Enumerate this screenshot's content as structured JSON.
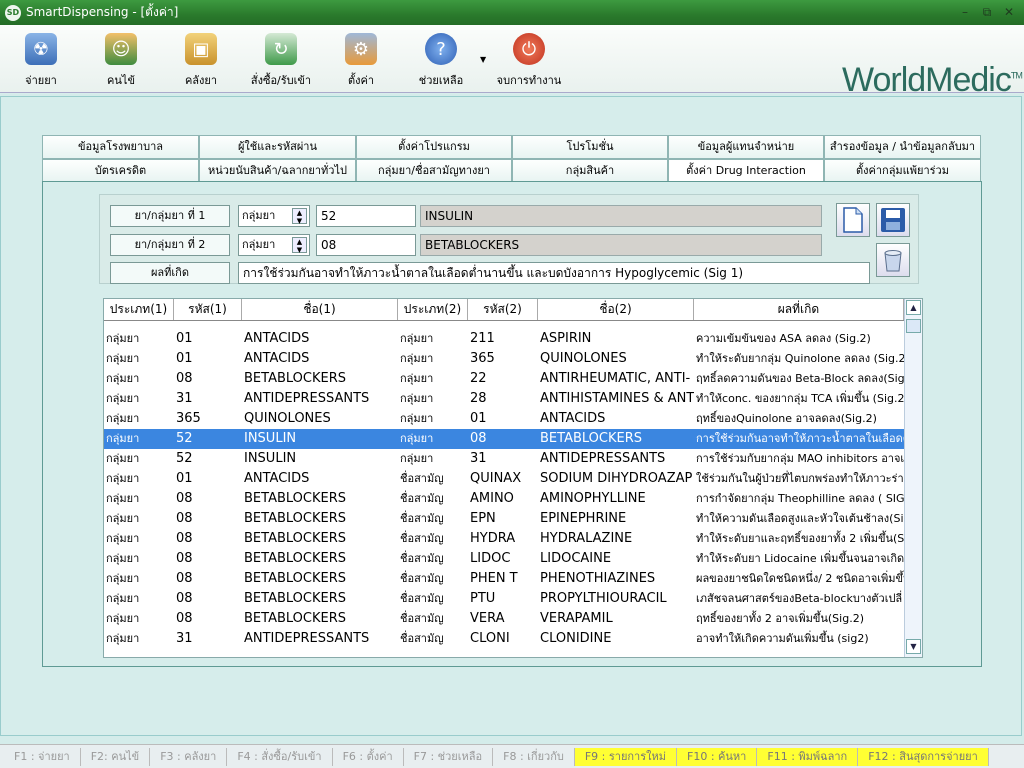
{
  "window": {
    "title": "SmartDispensing - [ตั้งค่า]",
    "app_icon_text": "SD"
  },
  "toolbar": {
    "items": [
      {
        "label": "จ่ายยา",
        "icon": "dispense-icon"
      },
      {
        "label": "คนไข้",
        "icon": "patients-icon"
      },
      {
        "label": "คลังยา",
        "icon": "inventory-icon"
      },
      {
        "label": "สั่งซื้อ/รับเข้า",
        "icon": "order-icon"
      },
      {
        "label": "ตั้งค่า",
        "icon": "settings-icon"
      },
      {
        "label": "ช่วยเหลือ",
        "icon": "help-icon"
      },
      {
        "label": "จบการทำงาน",
        "icon": "power-icon"
      }
    ],
    "logo": "WorldMedic",
    "logo_mark": "TM"
  },
  "tabs": {
    "row1": [
      "ข้อมูลโรงพยาบาล",
      "ผู้ใช้และรหัสผ่าน",
      "ตั้งค่าโปรแกรม",
      "โปรโมชั่น",
      "ข้อมูลผู้แทนจำหน่าย",
      "สำรองข้อมูล / นำข้อมูลกลับมา"
    ],
    "row2": [
      "บัตรเครดิต",
      "หน่วยนับสินค้า/ฉลากยาทั่วไป",
      "กลุ่มยา/ชื่อสามัญทางยา",
      "กลุ่มสินค้า",
      "ตั้งค่า Drug Interaction",
      "ตั้งค่ากลุ่มแพ้ยาร่วม"
    ],
    "active": "ตั้งค่า Drug Interaction"
  },
  "form": {
    "drug1_label": "ยา/กลุ่มยา ที่ 1",
    "drug2_label": "ยา/กลุ่มยา ที่ 2",
    "effect_label": "ผลที่เกิด",
    "drug1_type": "กลุ่มยา",
    "drug2_type": "กลุ่มยา",
    "drug1_code": "52",
    "drug2_code": "08",
    "drug1_name": "INSULIN",
    "drug2_name": "BETABLOCKERS",
    "effect": "การใช้ร่วมกันอาจทำให้ภาวะน้ำตาลในเลือดต่ำนานขึ้น และบดบังอาการ Hypoglycemic (Sig 1)"
  },
  "grid": {
    "columns": [
      "ประเภท(1)",
      "รหัส(1)",
      "ชื่อ(1)",
      "ประเภท(2)",
      "รหัส(2)",
      "ชื่อ(2)",
      "ผลที่เกิด"
    ],
    "selected_index": 5,
    "rows": [
      [
        "กลุ่มยา",
        "01",
        "ANTACIDS",
        "กลุ่มยา",
        "211",
        "ASPIRIN",
        "ความเข้มข้นของ ASA ลดลง (Sig.2)"
      ],
      [
        "กลุ่มยา",
        "01",
        "ANTACIDS",
        "กลุ่มยา",
        "365",
        "QUINOLONES",
        "ทำให้ระดับยากลุ่ม Quinolone ลดลง (Sig.2"
      ],
      [
        "กลุ่มยา",
        "08",
        "BETABLOCKERS",
        "กลุ่มยา",
        "22",
        "ANTIRHEUMATIC, ANTI-",
        "ฤทธิ์ลดความดันของ Beta-Block ลดลง(Sig"
      ],
      [
        "กลุ่มยา",
        "31",
        "ANTIDEPRESSANTS",
        "กลุ่มยา",
        "28",
        "ANTIHISTAMINES & ANT",
        "ทำให้conc. ของยากลุ่ม TCA เพิ่มขึ้น (Sig.2"
      ],
      [
        "กลุ่มยา",
        "365",
        "QUINOLONES",
        "กลุ่มยา",
        "01",
        "ANTACIDS",
        "ฤทธิ์ของQuinolone อาจลดลง(Sig.2)"
      ],
      [
        "กลุ่มยา",
        "52",
        "INSULIN",
        "กลุ่มยา",
        "08",
        "BETABLOCKERS",
        "การใช้ร่วมกันอาจทำให้ภาวะน้ำตาลในเลือดต่ำ"
      ],
      [
        "กลุ่มยา",
        "52",
        "INSULIN",
        "กลุ่มยา",
        "31",
        "ANTIDEPRESSANTS",
        "การใช้ร่วมกับยากลุ่ม MAO inhibitors อาจเ"
      ],
      [
        "กลุ่มยา",
        "01",
        "ANTACIDS",
        "ชื่อสามัญ",
        "QUINAX",
        "SODIUM DIHYDROAZAP",
        "ใช้ร่วมกันในผู้ป่วยที่ไตบกพร่องทำให้ภาวะร่าง"
      ],
      [
        "กลุ่มยา",
        "08",
        "BETABLOCKERS",
        "ชื่อสามัญ",
        "AMINO",
        "AMINOPHYLLINE",
        "การกำจัดยากลุ่ม Theophilline ลดลง ( SIG"
      ],
      [
        "กลุ่มยา",
        "08",
        "BETABLOCKERS",
        "ชื่อสามัญ",
        "EPN",
        "EPINEPHRINE",
        "ทำให้ความดันเลือดสูงและหัวใจเต้นช้าลง(Sig"
      ],
      [
        "กลุ่มยา",
        "08",
        "BETABLOCKERS",
        "ชื่อสามัญ",
        "HYDRA",
        "HYDRALAZINE",
        "ทำให้ระดับยาและฤทธิ์ของยาทั้ง 2 เพิ่มขึ้น(Si"
      ],
      [
        "กลุ่มยา",
        "08",
        "BETABLOCKERS",
        "ชื่อสามัญ",
        "LIDOC",
        "LIDOCAINE",
        "ทำให้ระดับยา Lidocaine เพิ่มขึ้นจนอาจเกิด"
      ],
      [
        "กลุ่มยา",
        "08",
        "BETABLOCKERS",
        "ชื่อสามัญ",
        "PHEN T",
        "PHENOTHIAZINES",
        "ผลของยาชนิดใดชนิดหนึ่ง/ 2 ชนิดอาจเพิ่มขึ้น"
      ],
      [
        "กลุ่มยา",
        "08",
        "BETABLOCKERS",
        "ชื่อสามัญ",
        "PTU",
        "PROPYLTHIOURACIL",
        "เภสัชจลนศาสตร์ของBeta-blockบางตัวเปลี่"
      ],
      [
        "กลุ่มยา",
        "08",
        "BETABLOCKERS",
        "ชื่อสามัญ",
        "VERA",
        "VERAPAMIL",
        "ฤทธิ์ของยาทั้ง 2 อาจเพิ่มขึ้น(Sig.2)"
      ],
      [
        "กลุ่มยา",
        "31",
        "ANTIDEPRESSANTS",
        "ชื่อสามัญ",
        "CLONI",
        "CLONIDINE",
        "อาจทำให้เกิดความดันเพิ่มขึ้น (sig2)"
      ]
    ]
  },
  "statusbar": {
    "keys": [
      {
        "label": "F1 : จ่ายยา",
        "highlight": false
      },
      {
        "label": "F2: คนไข้",
        "highlight": false
      },
      {
        "label": "F3 : คลังยา",
        "highlight": false
      },
      {
        "label": "F4 : สั่งซื้อ/รับเข้า",
        "highlight": false
      },
      {
        "label": "F6 : ตั้งค่า",
        "highlight": false
      },
      {
        "label": "F7 : ช่วยเหลือ",
        "highlight": false
      },
      {
        "label": "F8 : เกี่ยวกับ",
        "highlight": false
      },
      {
        "label": "F9 : รายการใหม่",
        "highlight": true
      },
      {
        "label": "F10 : ค้นหา",
        "highlight": true
      },
      {
        "label": "F11 : พิมพ์ฉลาก",
        "highlight": true
      },
      {
        "label": "F12 : สินสุดการจ่ายยา",
        "highlight": true
      }
    ]
  },
  "colors": {
    "titlebar": "#2a7a2c",
    "selection": "#3b86e0",
    "hotkey_highlight": "#ffff33",
    "logo": "#2c6b5e"
  }
}
